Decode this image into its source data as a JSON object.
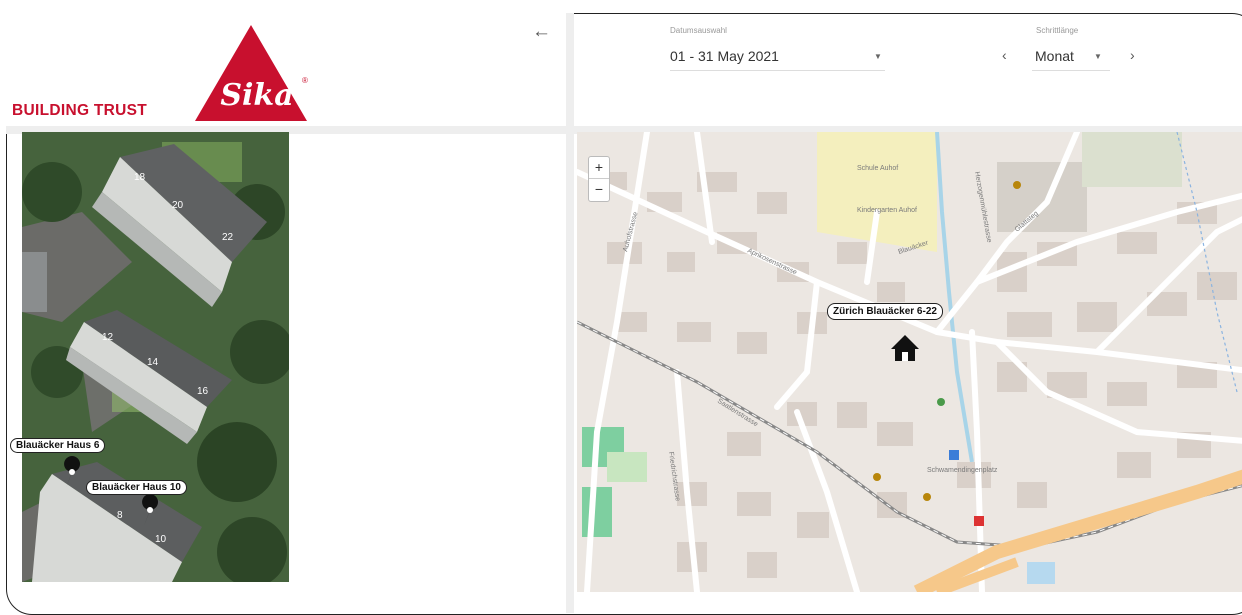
{
  "header": {
    "brand_text": "BUILDING TRUST",
    "logo_text": "Sika",
    "registered_mark": "®",
    "back_icon": "←"
  },
  "controls": {
    "date_label": "Datumsauswahl",
    "date_value": "01 - 31 May 2021",
    "step_label": "Schrittlänge",
    "step_value": "Monat",
    "prev_icon": "‹",
    "next_icon": "›",
    "dropdown_icon": "▼"
  },
  "aerial": {
    "house_numbers": [
      "18",
      "20",
      "22",
      "12",
      "14",
      "16",
      "8",
      "10"
    ],
    "labels": {
      "haus6": "Blauäcker Haus 6",
      "haus10": "Blauäcker Haus 10"
    }
  },
  "map": {
    "zoom_in": "+",
    "zoom_out": "−",
    "location_label": "Zürich Blauäcker 6-22",
    "place_labels": {
      "school": "Schule Auhof",
      "kindergarten": "Kindergarten Auhof",
      "street_blauacker": "Blauäcker",
      "street_aprikosen": "Aprikosenstrasse",
      "street_auhof": "Auhofstrasse",
      "street_saatlen": "Saatlenstrasse",
      "street_friedrich": "Friedrichstrasse",
      "street_herzogenmuehle": "Herzogenmühlestrasse",
      "street_glattsteg": "Glattsteg",
      "street_schwamendingen": "Schwamendingenplatz"
    }
  },
  "colors": {
    "brand_red": "#c8102e",
    "map_background": "#ece7e2",
    "street": "#ffffff",
    "highway": "#f6c88a",
    "water": "#a8d4e8",
    "park": "#c8e6c0",
    "school_area": "#f4efbe",
    "building": "#d9d0c9"
  }
}
